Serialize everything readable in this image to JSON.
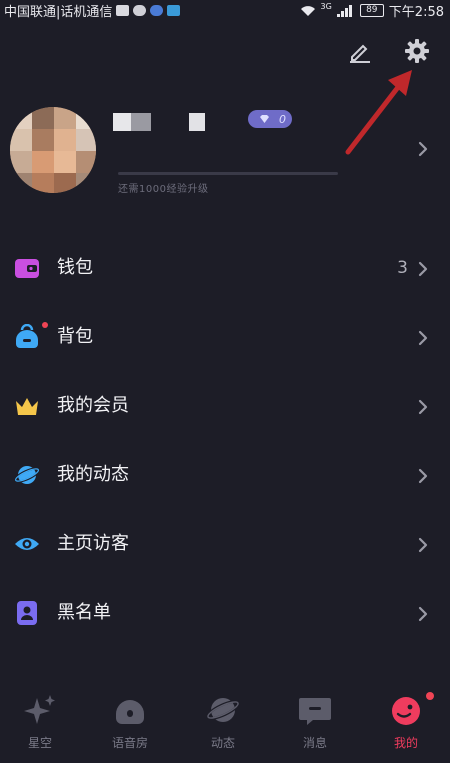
{
  "status_bar": {
    "carrier": "中国联通|话机通信",
    "network": "3G",
    "battery": "89",
    "time": "下午2:58"
  },
  "header": {
    "edit_icon": "pencil-icon",
    "settings_icon": "gear-icon"
  },
  "profile": {
    "upgrade_hint": "还需1000经验升级",
    "level": "0"
  },
  "menu": [
    {
      "label": "钱包",
      "icon": "wallet-icon",
      "color": "#c94fe0",
      "count": "3"
    },
    {
      "label": "背包",
      "icon": "backpack-icon",
      "color": "#3fa9f5",
      "count": "",
      "dot": true
    },
    {
      "label": "我的会员",
      "icon": "crown-icon",
      "color": "#f5c64a",
      "count": ""
    },
    {
      "label": "我的动态",
      "icon": "planet-icon",
      "color": "#3fa9f5",
      "count": ""
    },
    {
      "label": "主页访客",
      "icon": "eye-icon",
      "color": "#3fa9f5",
      "count": ""
    },
    {
      "label": "黑名单",
      "icon": "blocked-user-icon",
      "color": "#7a6cf0",
      "count": ""
    }
  ],
  "bottom_nav": [
    {
      "label": "星空",
      "icon": "sparkle-icon"
    },
    {
      "label": "语音房",
      "icon": "voice-room-icon"
    },
    {
      "label": "动态",
      "icon": "planet-icon"
    },
    {
      "label": "消息",
      "icon": "message-icon"
    },
    {
      "label": "我的",
      "icon": "profile-icon",
      "active": true
    }
  ],
  "colors": {
    "background": "#1d1d27",
    "accent": "#ef3c5e",
    "annotation_arrow": "#c0282b"
  }
}
